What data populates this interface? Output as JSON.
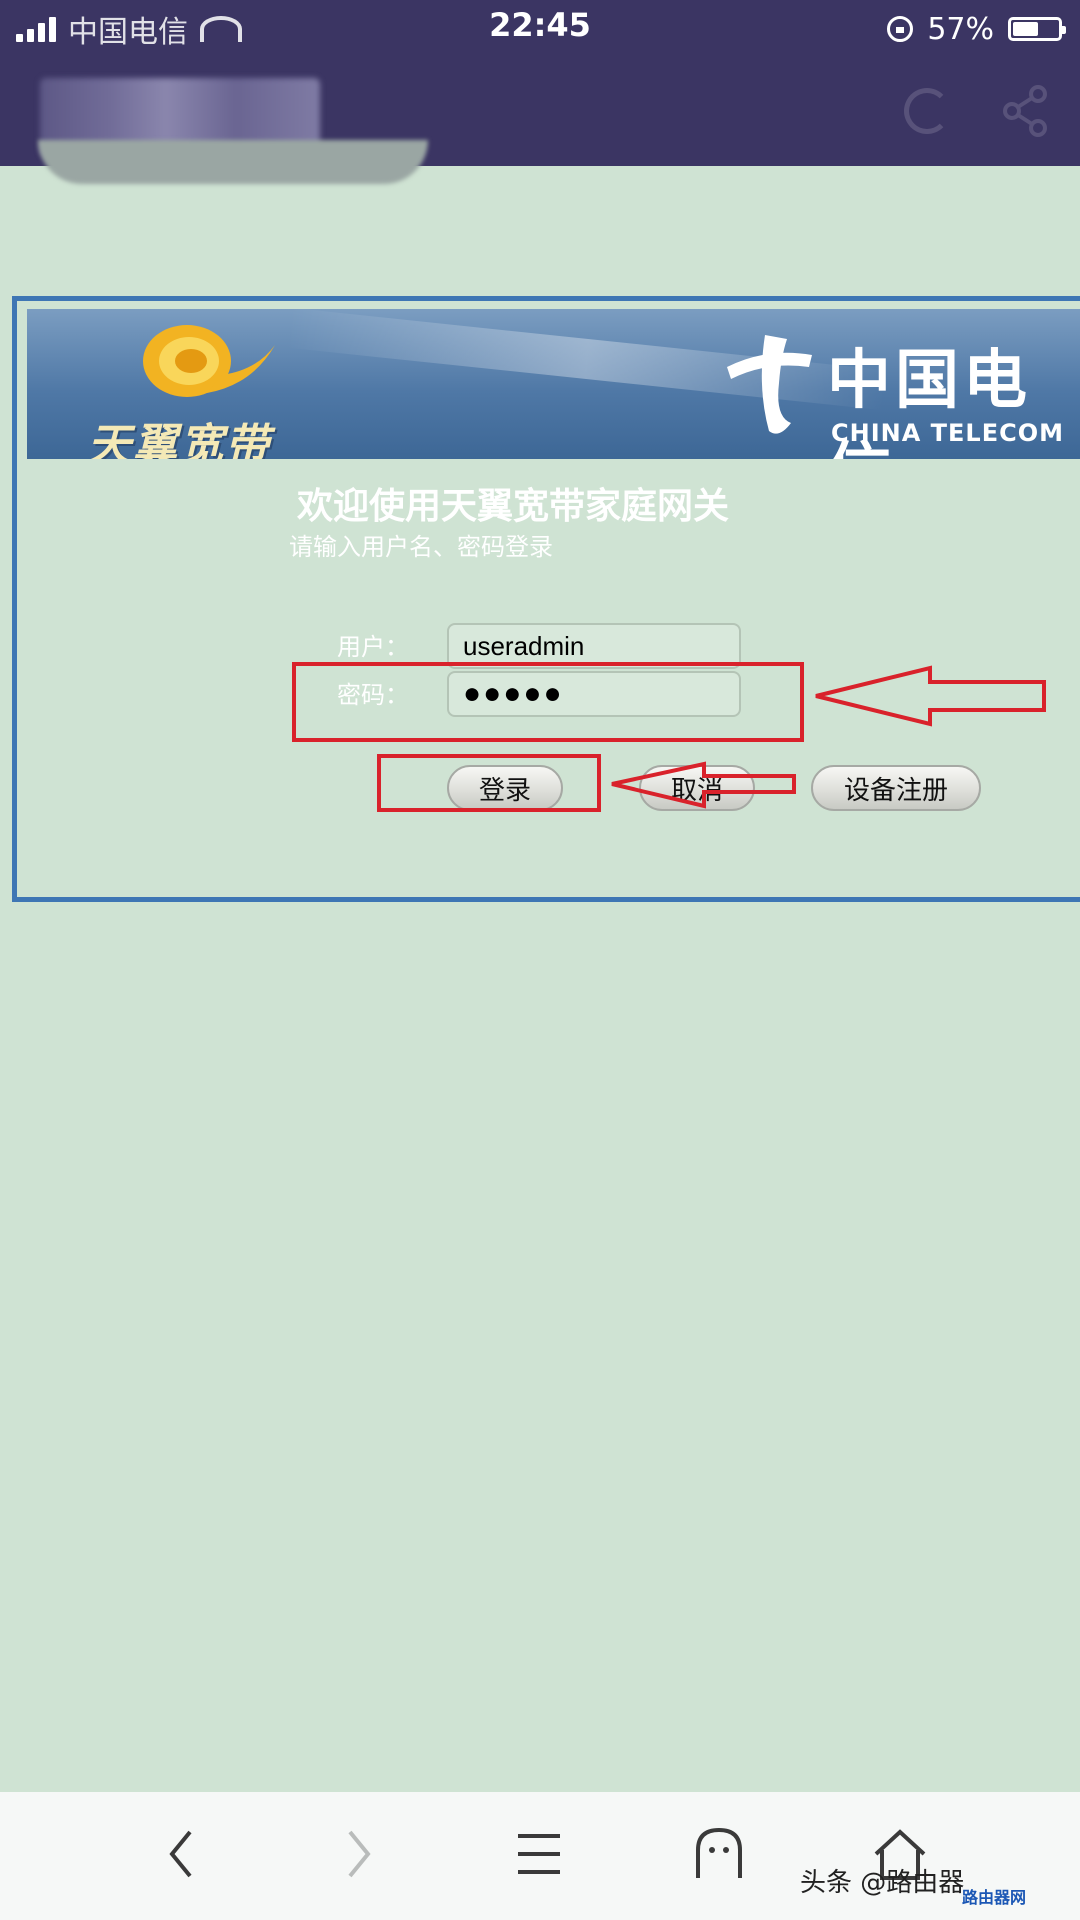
{
  "status_bar": {
    "carrier": "中国电信",
    "time": "22:45",
    "battery_percent": "57%",
    "battery_level": 0.57
  },
  "router": {
    "brand_logo_text": "天翼宽带",
    "carrier_logo_cn": "中国电信",
    "carrier_logo_en": "CHINA TELECOM",
    "welcome_title": "欢迎使用天翼宽带家庭网关",
    "hint": "请输入用户名、密码登录",
    "user_label": "用户：",
    "user_value": "useradmin",
    "password_label": "密码：",
    "password_mask": "●●●●●",
    "login_button": "登录",
    "cancel_button": "取消",
    "register_button": "设备注册"
  },
  "annotation_color": "#d9222b",
  "panel_border_color": "#3e76b4",
  "watermark": "头条 @路由器",
  "watermark_small": "路由器网"
}
